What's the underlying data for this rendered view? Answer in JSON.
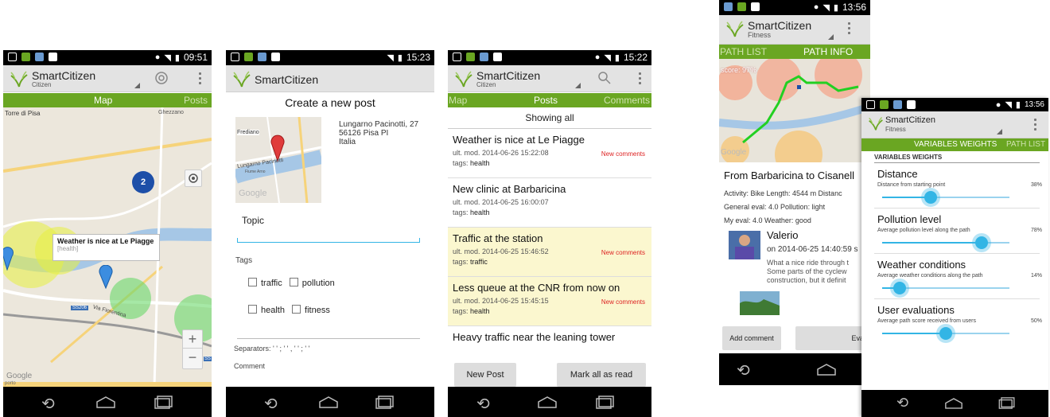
{
  "screen1": {
    "time": "09:51",
    "app_title": "SmartCitizen",
    "app_subtitle": "Citizen",
    "tabs": [
      "Map",
      "Posts"
    ],
    "map_labels": [
      "Torre di Pisa",
      "Ghezzano",
      "SS206",
      "Via Fiorentina",
      "SS",
      "Google",
      "porto"
    ],
    "cluster_count": "2",
    "callout_title": "Weather is nice at Le Piagge",
    "callout_tag": "[health]",
    "zoom_in": "+",
    "zoom_out": "−"
  },
  "screen2": {
    "time": "15:23",
    "app_title": "SmartCitizen",
    "header": "Create a new post",
    "address": [
      "Lungarno Pacinotti, 27",
      "56126 Pisa PI",
      "Italia"
    ],
    "map_labels": [
      "Frediano",
      "Lungarno Pacinotti",
      "Fiume Arno",
      "Google"
    ],
    "topic_label": "Topic",
    "tags_label": "Tags",
    "tag_options": [
      "traffic",
      "pollution",
      "health",
      "fitness"
    ],
    "separators": "Separators: ' ' ; ' ' , ' ' ; ' '",
    "comment_label": "Comment"
  },
  "screen3": {
    "time": "15:22",
    "app_title": "SmartCitizen",
    "app_subtitle": "Citizen",
    "tabs": [
      "Map",
      "Posts",
      "Comments"
    ],
    "showing": "Showing all",
    "posts": [
      {
        "title": "Weather is nice at Le Piagge",
        "modified": "ult. mod. 2014-06-26 15:22:08",
        "tags_prefix": "tags: ",
        "tags": "health",
        "badge": "New comments",
        "highlight": false
      },
      {
        "title": "New clinic at Barbaricina",
        "modified": "ult. mod. 2014-06-25 16:00:07",
        "tags_prefix": "tags: ",
        "tags": "health",
        "badge": "",
        "highlight": false
      },
      {
        "title": "Traffic at the station",
        "modified": "ult. mod. 2014-06-25 15:46:52",
        "tags_prefix": "tags: ",
        "tags": "traffic",
        "badge": "New comments",
        "highlight": true
      },
      {
        "title": "Less queue at the CNR from now on",
        "modified": "ult. mod. 2014-06-25 15:45:15",
        "tags_prefix": "tags: ",
        "tags": "health",
        "badge": "New comments",
        "highlight": true
      },
      {
        "title": "Heavy traffic near the leaning tower",
        "modified": "",
        "tags_prefix": "",
        "tags": "",
        "badge": "",
        "highlight": false
      }
    ],
    "new_post": "New Post",
    "mark_all": "Mark all as read"
  },
  "screen4": {
    "time": "13:56",
    "app_title": "SmartCitizen",
    "app_subtitle": "Fitness",
    "tabs": [
      "PATH LIST",
      "PATH INFO"
    ],
    "score": "score: 97%",
    "path_title": "From Barbaricina to Cisanell",
    "info1": "Activity: Bike Length: 4544 m Distanc",
    "info2": "General eval: 4.0 Pollution: light",
    "info3": "My eval: 4.0 Weather: good",
    "commenter": "Valerio",
    "comment_date": "on 2014-06-25 14:40:59 s",
    "comment_lines": [
      "What a nice ride through t",
      "Some parts of the cyclew",
      "construction, but it definit"
    ],
    "add_comment": "Add comment",
    "eval_btn": "Eva",
    "google": "Google"
  },
  "screen5": {
    "time": "13:56",
    "app_title": "SmartCitizen",
    "app_subtitle": "Fitness",
    "tabs": [
      "VARIABLES WEIGHTS",
      "PATH LIST"
    ],
    "section": "VARIABLES WEIGHTS",
    "weights": [
      {
        "name": "Distance",
        "desc": "Distance from starting point",
        "pct": "38%",
        "value": 0.38
      },
      {
        "name": "Pollution level",
        "desc": "Average pollution level along the path",
        "pct": "78%",
        "value": 0.78
      },
      {
        "name": "Weather conditions",
        "desc": "Average weather conditions along the path",
        "pct": "14%",
        "value": 0.14
      },
      {
        "name": "User evaluations",
        "desc": "Average path score received from users",
        "pct": "50%",
        "value": 0.5
      }
    ]
  },
  "colors": {
    "green_tab": "#6aa622",
    "blue_accent": "#33b5e5",
    "new_comments": "#dd2222",
    "highlight_row": "#fbf7cf"
  }
}
